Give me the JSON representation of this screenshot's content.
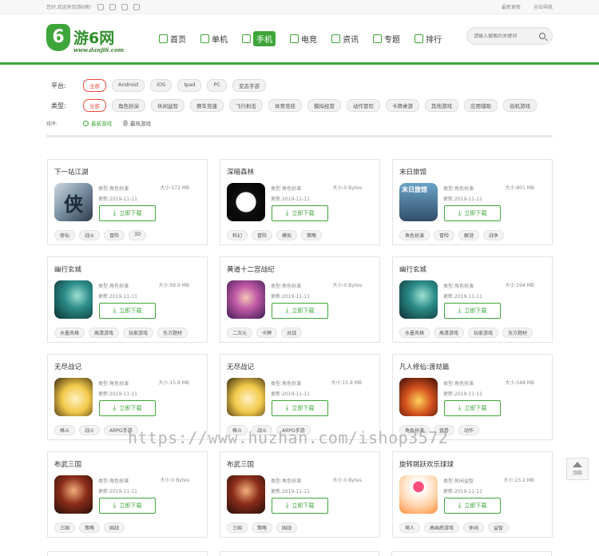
{
  "topbar": {
    "welcome": "您好,欢迎来到游6网!",
    "latest": "最新更新",
    "sitenav": "全站导航"
  },
  "logo": {
    "text": "游6网",
    "url": "www.danji6.com"
  },
  "nav": [
    {
      "label": "首页",
      "icon": "home-icon",
      "active": false
    },
    {
      "label": "单机",
      "icon": "gamepad-icon",
      "active": false
    },
    {
      "label": "手机",
      "icon": "phone-icon",
      "active": true
    },
    {
      "label": "电竞",
      "icon": "controller-icon",
      "active": false
    },
    {
      "label": "资讯",
      "icon": "news-icon",
      "active": false
    },
    {
      "label": "专题",
      "icon": "topic-icon",
      "active": false
    },
    {
      "label": "排行",
      "icon": "ranking-icon",
      "active": false
    }
  ],
  "search": {
    "placeholder": "请输入搜索的关键词"
  },
  "filters": {
    "platform_label": "平台:",
    "platforms": [
      "全部",
      "Android",
      "IOS",
      "Ipad",
      "PC",
      "变态手游"
    ],
    "type_label": "类型:",
    "types": [
      "全部",
      "角色扮演",
      "休闲益智",
      "赛车竞速",
      "飞行射击",
      "体育竞技",
      "模拟经营",
      "动作冒险",
      "卡牌桌游",
      "其他游戏",
      "应用辅助",
      "街机游戏"
    ],
    "sort_label": "排序:",
    "sorts": [
      "最新游戏",
      "最热游戏"
    ]
  },
  "download_label": "立即下载",
  "games": [
    {
      "name": "下一站江湖",
      "type": "类型:角色扮演",
      "updated": "更新:2019-11-11",
      "size": "大小:172 MB",
      "art": "art-ink",
      "art_text": "侠",
      "tags": [
        "修仙",
        "战斗",
        "冒险",
        "3D"
      ]
    },
    {
      "name": "深暗森林",
      "type": "类型:角色扮演",
      "updated": "更新:2019-11-11",
      "size": "大小:0 Bytes",
      "art": "art-dark",
      "art_text": "",
      "tags": [
        "科幻",
        "冒险",
        "模拟",
        "策略"
      ]
    },
    {
      "name": "末日旅馆",
      "type": "类型:角色扮演",
      "updated": "更新:2019-11-11",
      "size": "大小:801 MB",
      "art": "art-end",
      "art_text": "末日旅馆",
      "tags": [
        "角色扮演",
        "冒险",
        "解谜",
        "战争"
      ]
    },
    {
      "name": "幽行玄城",
      "type": "类型:角色扮演",
      "updated": "更新:2019-11-11",
      "size": "大小:99.9 MB",
      "art": "art-teal",
      "art_text": "",
      "tags": [
        "水墨风格",
        "高清游戏",
        "玩家游戏",
        "东方题材"
      ]
    },
    {
      "name": "黄道十二宫战纪",
      "type": "类型:角色扮演",
      "updated": "更新:2019-11-11",
      "size": "大小:0 Bytes",
      "art": "art-purple",
      "art_text": "",
      "tags": [
        "二次元",
        "卡牌",
        "对战"
      ]
    },
    {
      "name": "幽行玄城",
      "type": "类型:角色扮演",
      "updated": "更新:2019-11-11",
      "size": "大小:194 MB",
      "art": "art-teal",
      "art_text": "",
      "tags": [
        "水墨风格",
        "高清游戏",
        "玩家游戏",
        "东方题材"
      ]
    },
    {
      "name": "无尽战记",
      "type": "类型:角色扮演",
      "updated": "更新:2019-11-11",
      "size": "大小:15.8 MB",
      "art": "art-yellow",
      "art_text": "",
      "tags": [
        "格斗",
        "战斗",
        "ARPG手游"
      ]
    },
    {
      "name": "无尽战记",
      "type": "类型:角色扮演",
      "updated": "更新:2019-11-11",
      "size": "大小:15.8 MB",
      "art": "art-yellow",
      "art_text": "",
      "tags": [
        "格斗",
        "战斗",
        "ARPG手游"
      ]
    },
    {
      "name": "凡人修仙:渡劫篇",
      "type": "类型:角色扮演",
      "updated": "更新:2019-11-11",
      "size": "大小:548 MB",
      "art": "art-fire",
      "art_text": "",
      "tags": [
        "角色扮演",
        "修卷",
        "动作"
      ]
    },
    {
      "name": "布武三国",
      "type": "类型:角色扮演",
      "updated": "更新:2019-11-11",
      "size": "大小:0 Bytes",
      "art": "art-warrior",
      "art_text": "",
      "tags": [
        "三国",
        "策略",
        "国战"
      ]
    },
    {
      "name": "布武三国",
      "type": "类型:角色扮演",
      "updated": "更新:2019-11-11",
      "size": "大小:0 Bytes",
      "art": "art-warrior",
      "art_text": "",
      "tags": [
        "三国",
        "策略",
        "国战"
      ]
    },
    {
      "name": "旋转跳跃欢乐球球",
      "type": "类型:休闲益智",
      "updated": "更新:2019-11-11",
      "size": "大小:23.2 MB",
      "art": "art-ball",
      "art_text": "",
      "tags": [
        "萌人",
        "高画质游戏",
        "休闲",
        "益智"
      ]
    }
  ],
  "totop_label": "顶部",
  "watermark": "https://www.huzhan.com/ishop3572"
}
